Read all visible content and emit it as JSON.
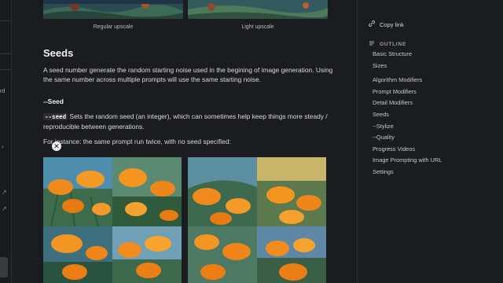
{
  "captions": [
    "Regular upscale",
    "Light upscale"
  ],
  "section": {
    "title": "Seeds",
    "intro": "A seed number generate the random starting noise used in the begining of image generation. Using the same number across multiple prompts will use the same starting noise."
  },
  "subsection": {
    "title": "--Seed",
    "code": "--seed",
    "desc": " Sets the random seed (an integer), which can sometimes help keep things more steady / reproducible between generations.",
    "example": "For instance: the same prompt run twice, with no seed specified:"
  },
  "left_rail": {
    "text_fragment": "rd"
  },
  "sidebar": {
    "copy_link": "Copy link",
    "outline_label": "OUTLINE",
    "items": [
      "Basic Structure",
      "Sizes",
      "Algorithm Modifiers",
      "Prompt Modifiers",
      "Detail Modifiers",
      "Seeds",
      "--Stylize",
      "--Quality",
      "Progress Videos",
      "Image Prompting with URL",
      "Settings"
    ]
  },
  "colors": {
    "background": "#1b1c20",
    "poppy": "#f08a1c",
    "foliage": "#3f6b4a",
    "sky": "#6f9fb4"
  }
}
